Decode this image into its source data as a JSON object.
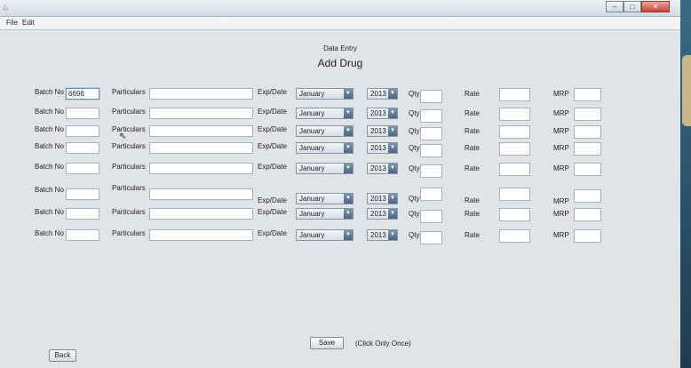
{
  "window": {
    "title": "",
    "controls": [
      "–",
      "□",
      "✕"
    ]
  },
  "menu": {
    "file": "File",
    "edit": "Edit"
  },
  "header": {
    "subtitle": "Data Entry",
    "title": "Add Drug"
  },
  "labels": {
    "batch": "Batch No",
    "particulars": "Particulars",
    "expdate": "Exp/Date",
    "qty": "Qty",
    "rate": "Rate",
    "mrp": "MRP"
  },
  "rows": [
    {
      "batch": "6696",
      "month": "January",
      "year": "2013"
    },
    {
      "batch": "",
      "month": "January",
      "year": "2013"
    },
    {
      "batch": "",
      "month": "January",
      "year": "2013"
    },
    {
      "batch": "",
      "month": "January",
      "year": "2013"
    },
    {
      "batch": "",
      "month": "January",
      "year": "2013"
    },
    {
      "batch": "",
      "month": "January",
      "year": "2013"
    },
    {
      "batch": "",
      "month": "January",
      "year": "2013"
    },
    {
      "batch": "",
      "month": "January",
      "year": "2013"
    }
  ],
  "footer": {
    "save": "Save",
    "note": "(Click Only Once)",
    "back": "Back"
  },
  "icons": {
    "app": "java-cup-icon",
    "dropdown": "chevron-down-icon",
    "pointer": "mouse-cursor-icon"
  }
}
